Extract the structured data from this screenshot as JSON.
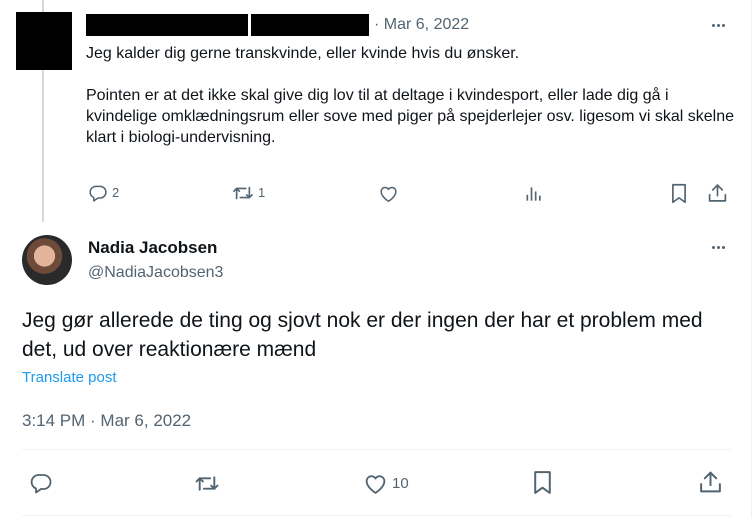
{
  "parent_tweet": {
    "date": "· Mar 6, 2022",
    "paragraph_1": "Jeg kalder dig gerne transkvinde, eller kvinde hvis du ønsker.",
    "paragraph_2": "Pointen er at det ikke skal give dig lov til at deltage i kvindesport, eller lade dig gå i kvindelige omklædningsrum eller sove med piger på spejderlejer osv. ligesom vi skal skelne klart i biologi-undervisning.",
    "reply_count": "2",
    "repost_count": "1",
    "icons": [
      "reply-icon",
      "repost-icon",
      "like-icon",
      "views-icon",
      "bookmark-icon",
      "share-icon",
      "more-icon"
    ]
  },
  "main_tweet": {
    "author_name": "Nadia Jacobsen",
    "author_handle": "@NadiaJacobsen3",
    "text": "Jeg gør allerede de ting og sjovt nok er der ingen der har et problem med det, ud over reaktionære mænd",
    "translate_label": "Translate post",
    "timestamp": "3:14 PM · Mar 6, 2022",
    "like_count": "10",
    "icons": [
      "reply-icon",
      "repost-icon",
      "like-icon",
      "bookmark-icon",
      "share-icon",
      "more-icon"
    ]
  },
  "colors": {
    "text_primary": "#0f1419",
    "text_secondary": "#536471",
    "link": "#1d9bf0",
    "divider": "#eff3f4",
    "thread_line": "#cfd9de"
  }
}
